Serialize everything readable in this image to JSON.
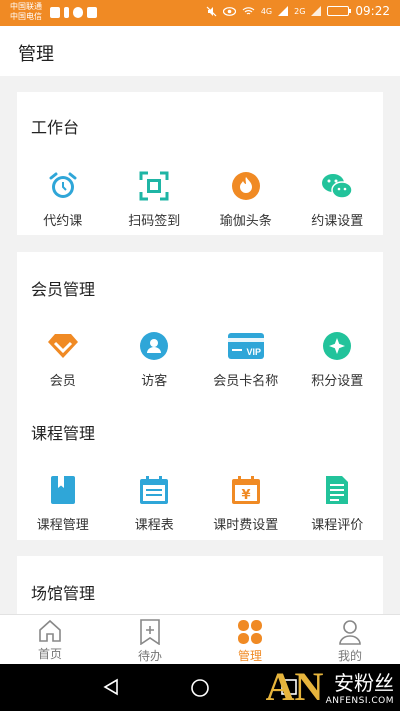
{
  "status_bar": {
    "carrier_1": "中国联通",
    "carrier_2": "中国电信",
    "signal_1": "4G",
    "signal_2": "2G",
    "time": "09:22",
    "color": "#f08a24"
  },
  "header": {
    "title": "管理"
  },
  "workbench": {
    "title": "工作台",
    "items": [
      {
        "label": "代约课",
        "icon": "alarm-clock-icon",
        "color": "#2fa6d8"
      },
      {
        "label": "扫码签到",
        "icon": "scan-qr-icon",
        "color": "#1fb5a5"
      },
      {
        "label": "瑜伽头条",
        "icon": "flame-icon",
        "color": "#f08a24"
      },
      {
        "label": "约课设置",
        "icon": "wechat-icon",
        "color": "#22c39b"
      }
    ]
  },
  "member_mgmt": {
    "title": "会员管理",
    "items": [
      {
        "label": "会员",
        "icon": "diamond-icon",
        "color": "#f08a24"
      },
      {
        "label": "访客",
        "icon": "user-icon",
        "color": "#2fa6d8"
      },
      {
        "label": "会员卡名称",
        "icon": "vip-card-icon",
        "color": "#2fa6d8",
        "badge": "VIP"
      },
      {
        "label": "积分设置",
        "icon": "points-icon",
        "color": "#22c39b"
      }
    ]
  },
  "course_mgmt": {
    "title": "课程管理",
    "items": [
      {
        "label": "课程管理",
        "icon": "bookmark-book-icon",
        "color": "#2fa6d8"
      },
      {
        "label": "课程表",
        "icon": "calendar-icon",
        "color": "#2fa6d8"
      },
      {
        "label": "课时费设置",
        "icon": "yen-calendar-icon",
        "color": "#f08a24",
        "symbol": "¥"
      },
      {
        "label": "课程评价",
        "icon": "document-icon",
        "color": "#22c39b"
      }
    ]
  },
  "venue_mgmt": {
    "title": "场馆管理"
  },
  "tab_bar": {
    "active_color": "#f08a24",
    "tabs": [
      {
        "label": "首页",
        "icon": "home-icon",
        "active": false
      },
      {
        "label": "待办",
        "icon": "todo-bookmark-icon",
        "active": false
      },
      {
        "label": "管理",
        "icon": "grid-icon",
        "active": true
      },
      {
        "label": "我的",
        "icon": "person-icon",
        "active": false
      }
    ]
  },
  "watermark": {
    "logo": "AN",
    "name": "安粉丝",
    "url": "ANFENSI.COM"
  }
}
